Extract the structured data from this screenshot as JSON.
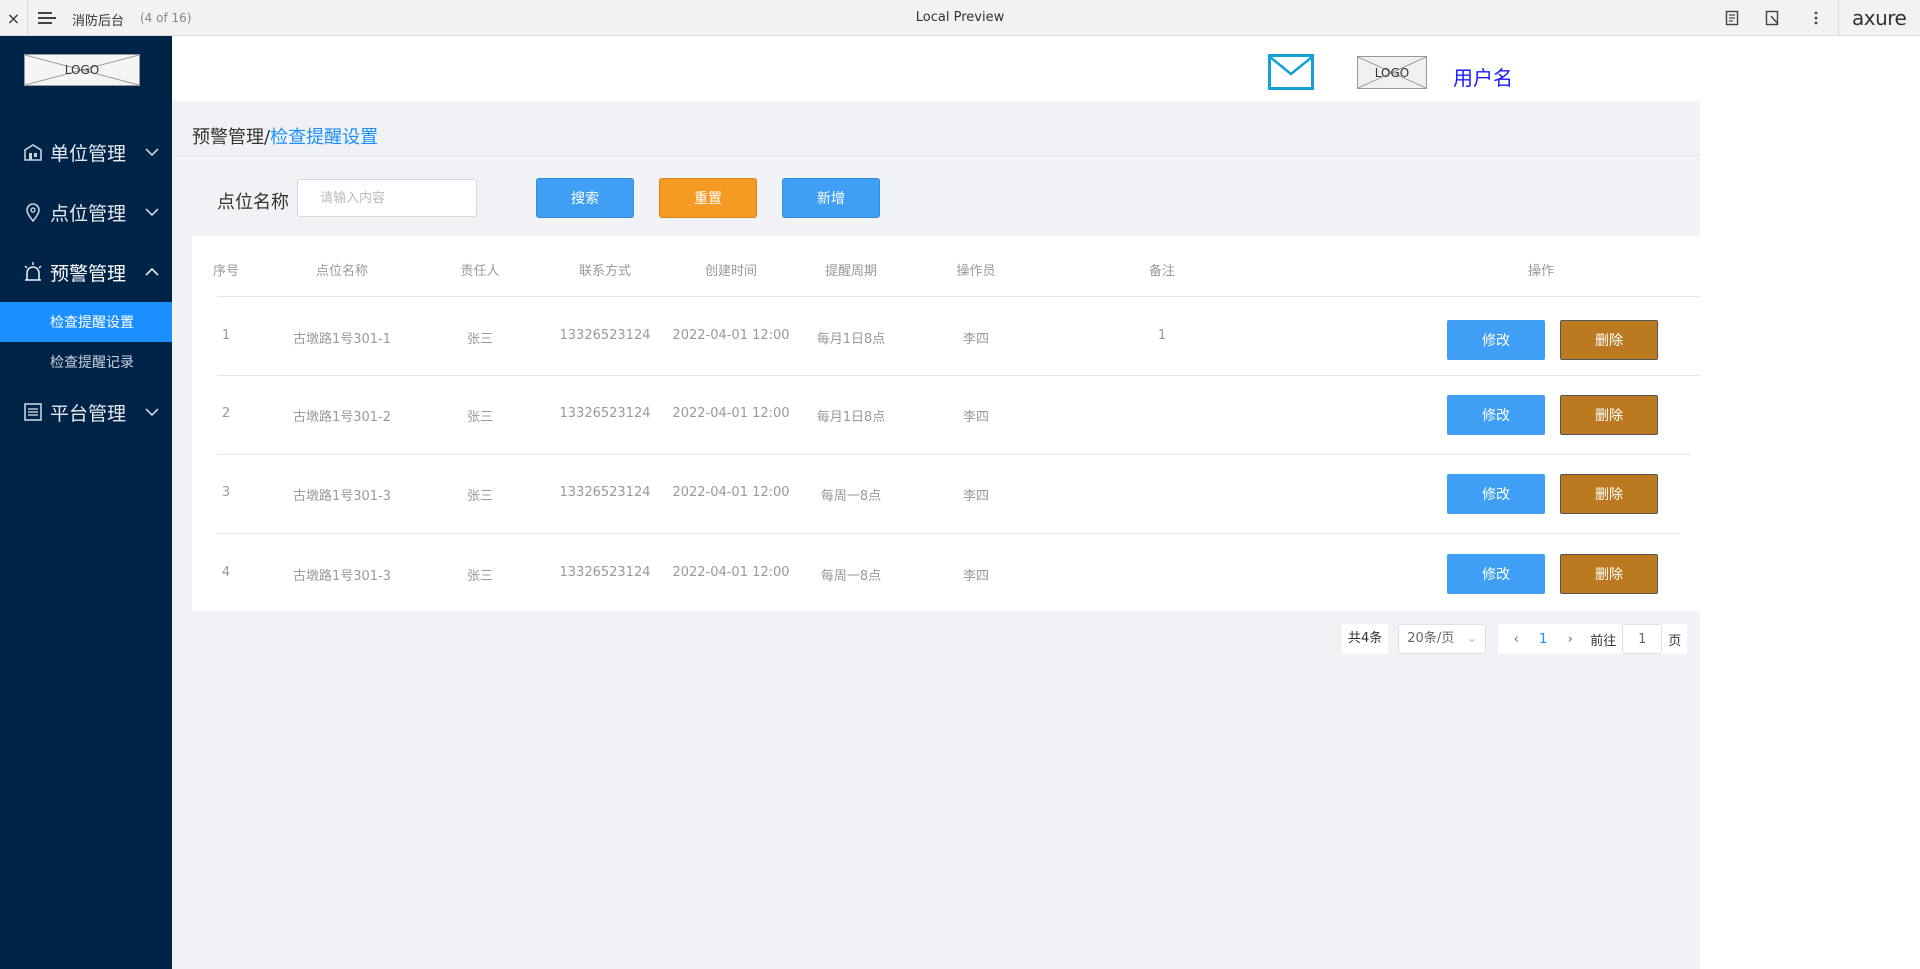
{
  "topbar": {
    "close": "×",
    "project_name": "消防后台",
    "page_count": "(4 of 16)",
    "center_title": "Local Preview",
    "brand": "axure"
  },
  "sidebar": {
    "logo_text": "LOGO",
    "menus": [
      {
        "label": "单位管理",
        "icon": "building-icon",
        "expanded": false
      },
      {
        "label": "点位管理",
        "icon": "location-pin-icon",
        "expanded": false
      },
      {
        "label": "预警管理",
        "icon": "alarm-icon",
        "expanded": true
      },
      {
        "label": "平台管理",
        "icon": "list-icon",
        "expanded": false
      }
    ],
    "submenu": [
      {
        "label": "检查提醒设置",
        "active": true
      },
      {
        "label": "检查提醒记录",
        "active": false
      }
    ]
  },
  "header": {
    "logo_text": "LOGO",
    "username": "用户名"
  },
  "breadcrumb": {
    "parent": "预警管理",
    "separator": "/",
    "current": "检查提醒设置"
  },
  "filter": {
    "label": "点位名称",
    "placeholder": "请输入内容",
    "search_label": "搜索",
    "reset_label": "重置",
    "add_label": "新增"
  },
  "table": {
    "columns": [
      "序号",
      "点位名称",
      "责任人",
      "联系方式",
      "创建时间",
      "提醒周期",
      "操作员",
      "备注",
      "操作"
    ],
    "rows": [
      [
        "1",
        "古墩路1号301-1",
        "张三",
        "13326523124",
        "2022-04-01 12:00",
        "每月1日8点",
        "李四",
        "1"
      ],
      [
        "2",
        "古墩路1号301-2",
        "张三",
        "13326523124",
        "2022-04-01 12:00",
        "每月1日8点",
        "李四",
        ""
      ],
      [
        "3",
        "古墩路1号301-3",
        "张三",
        "13326523124",
        "2022-04-01 12:00",
        "每周一8点",
        "李四",
        ""
      ],
      [
        "4",
        "古墩路1号301-3",
        "张三",
        "13326523124",
        "2022-04-01 12:00",
        "每周一8点",
        "李四",
        ""
      ]
    ],
    "edit_label": "修改",
    "delete_label": "删除"
  },
  "pager": {
    "total": "共4条",
    "page_size": "20条/页",
    "prev": "‹",
    "current_page": "1",
    "next": "›",
    "goto_label": "前往",
    "goto_value": "1",
    "page_suffix": "页"
  },
  "colors": {
    "sidebar_bg": "#002448",
    "active_sub": "#1a8fff",
    "primary": "#3e9ff5",
    "warning": "#f59a23",
    "danger_btn": "#bb7920",
    "content_bg": "#f0f2f5"
  }
}
